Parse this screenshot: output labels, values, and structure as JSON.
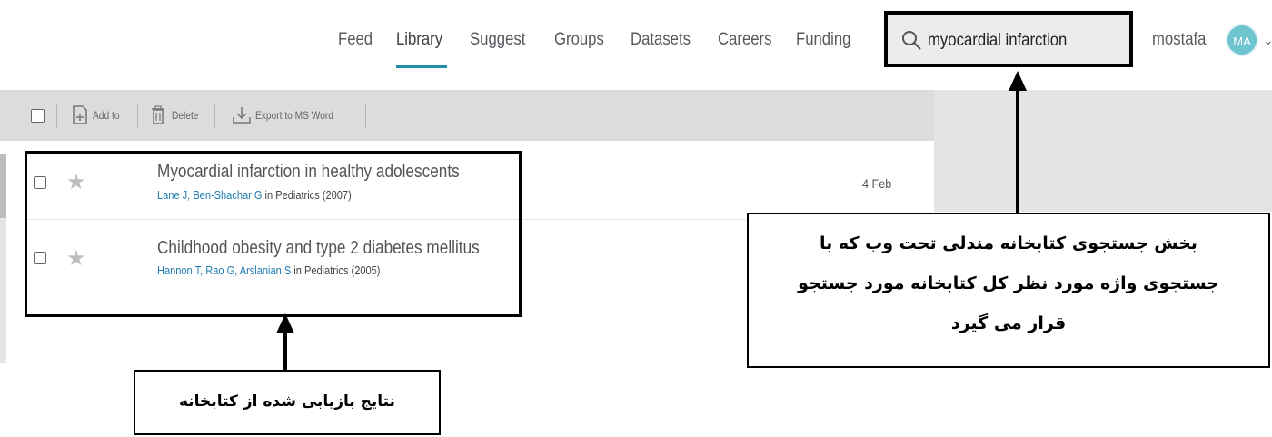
{
  "nav": {
    "items": [
      "Feed",
      "Library",
      "Suggest",
      "Groups",
      "Datasets",
      "Careers",
      "Funding"
    ],
    "active": "Library"
  },
  "search": {
    "value": "myocardial infarction"
  },
  "user": {
    "name": "mostafa",
    "initials": "MA"
  },
  "toolbar": {
    "add_to": "Add to",
    "delete": "Delete",
    "export": "Export to MS Word"
  },
  "results": [
    {
      "title": "Myocardial infarction in healthy adolescents",
      "authors": "Lane J, Ben-Shachar G",
      "venue": " in Pediatrics (2007)",
      "date": "4 Feb"
    },
    {
      "title": "Childhood obesity and type 2 diabetes mellitus",
      "authors": "Hannon T, Rao G, Arslanian S",
      "venue": " in Pediatrics (2005)",
      "date": ""
    }
  ],
  "annotations": {
    "search_caption_lines": [
      "بخش جستجوی کتابخانه مندلی تحت وب که با",
      "جستجوی واژه مورد نظر کل کتابخانه مورد جستجو",
      "قرار می گیرد"
    ],
    "results_caption": "نتایج بازیابی شده از کتابخانه"
  },
  "colors": {
    "accent": "#1d8fa8",
    "author_link": "#1f7cb0",
    "avatar": "#6ec4cf",
    "toolbar_bg": "#dcdcdc"
  }
}
